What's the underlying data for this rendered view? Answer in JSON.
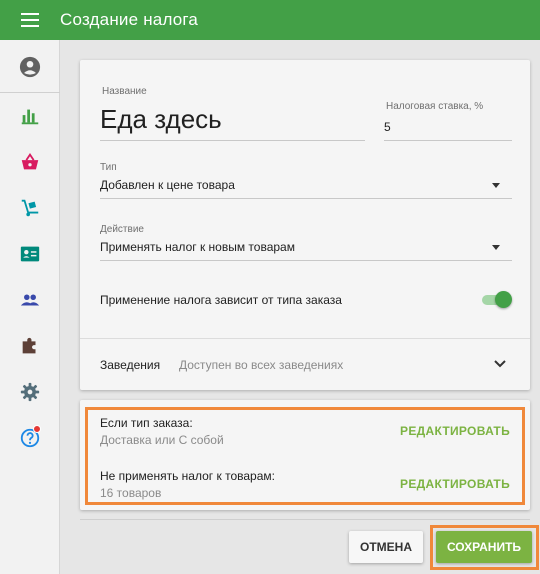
{
  "header": {
    "title": "Создание налога",
    "menu_icon": "menu-icon"
  },
  "sidebar": {
    "items": [
      {
        "icon": "account-icon"
      },
      {
        "icon": "bar-chart-icon"
      },
      {
        "icon": "basket-icon"
      },
      {
        "icon": "hand-truck-icon"
      },
      {
        "icon": "contact-card-icon"
      },
      {
        "icon": "people-icon"
      },
      {
        "icon": "puzzle-icon"
      },
      {
        "icon": "gear-icon"
      },
      {
        "icon": "help-icon",
        "badge": true
      }
    ]
  },
  "form": {
    "name_label": "Название",
    "name_value": "Еда здесь",
    "rate_label": "Налоговая ставка, %",
    "rate_value": "5",
    "type_label": "Тип",
    "type_value": "Добавлен к цене товара",
    "action_label": "Действие",
    "action_value": "Применять налог к новым товарам",
    "depends_label": "Применение налога зависит от типа заказа",
    "depends_toggle_on": true,
    "venues_label": "Заведения",
    "venues_value": "Доступен во всех заведениях"
  },
  "conditions": {
    "order_type_title": "Если тип заказа:",
    "order_type_value": "Доставка или С собой",
    "order_type_edit": "РЕДАКТИРОВАТЬ",
    "exclude_title": "Не применять налог к товарам:",
    "exclude_value": "16 товаров",
    "exclude_edit": "РЕДАКТИРОВАТЬ"
  },
  "actions": {
    "cancel_label": "ОТМЕНА",
    "save_label": "СОХРАНИТЬ"
  },
  "colors": {
    "appbar": "#43a047",
    "accent": "#7cb342",
    "highlight": "#f0883a",
    "sidebar_icons": [
      "#616161",
      "#43a047",
      "#d81b60",
      "#0097a7",
      "#00897b",
      "#3949ab",
      "#5d4037",
      "#546e7a",
      "#1e88e5"
    ]
  }
}
